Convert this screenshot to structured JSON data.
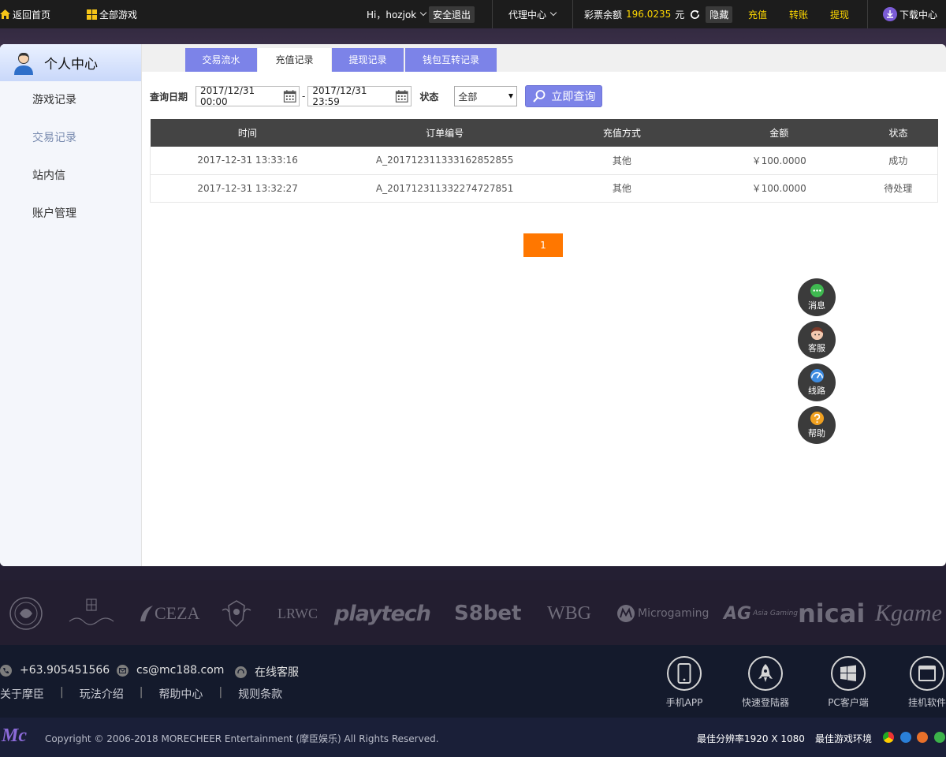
{
  "topbar": {
    "home_label": "返回首页",
    "all_games_label": "全部游戏",
    "greeting": "Hi，hozjok",
    "logout_label": "安全退出",
    "agent_center_label": "代理中心",
    "balance_label": "彩票余额",
    "balance_value": "196.0235",
    "currency": "元",
    "hide_label": "隐藏",
    "recharge_label": "充值",
    "transfer_label": "转账",
    "withdraw_label": "提现",
    "download_label": "下载中心"
  },
  "sidebar": {
    "title": "个人中心",
    "items": [
      {
        "label": "游戏记录"
      },
      {
        "label": "交易记录"
      },
      {
        "label": "站内信"
      },
      {
        "label": "账户管理"
      }
    ]
  },
  "tabs": [
    {
      "label": "交易流水"
    },
    {
      "label": "充值记录"
    },
    {
      "label": "提现记录"
    },
    {
      "label": "钱包互转记录"
    }
  ],
  "filter": {
    "date_label": "查询日期",
    "start": "2017/12/31 00:00",
    "dash": "-",
    "end": "2017/12/31 23:59",
    "status_label": "状态",
    "status_value": "全部",
    "query_label": "立即查询"
  },
  "table": {
    "headers": [
      "时间",
      "订单编号",
      "充值方式",
      "金额",
      "状态"
    ],
    "rows": [
      [
        "2017-12-31 13:33:16",
        "A_201712311333162852855",
        "其他",
        "￥100.0000",
        "成功"
      ],
      [
        "2017-12-31 13:32:27",
        "A_201712311332274727851",
        "其他",
        "￥100.0000",
        "待处理"
      ]
    ]
  },
  "pager": {
    "current": "1"
  },
  "float": {
    "message": "消息",
    "service": "客服",
    "route": "线路",
    "help": "帮助"
  },
  "partners": {
    "ceza": "CEZA",
    "lrwc": "LRWC",
    "playtech": "playtech",
    "sbet": "S8bet",
    "wbg": "WBG",
    "microgaming": "Microgaming",
    "ag": "AG",
    "ag_sub": "Asia Gaming",
    "nicai": "nicai",
    "kgame": "Kgame"
  },
  "footer": {
    "phone": "+63.905451566",
    "email": "cs@mc188.com",
    "online_service": "在线客服",
    "links": [
      "关于摩臣",
      "玩法介绍",
      "帮助中心",
      "规则条款"
    ],
    "link_sep": "|",
    "apps": [
      {
        "label": "手机APP"
      },
      {
        "label": "快速登陆器"
      },
      {
        "label": "PC客户端"
      },
      {
        "label": "挂机软件"
      }
    ]
  },
  "copyright": {
    "logo": "Mc",
    "text": "Copyright © 2006-2018 MORECHEER Entertainment (摩臣娱乐) All Rights Reserved.",
    "resolution": "最佳分辨率1920 X 1080",
    "env": "最佳游戏环境"
  },
  "colors": {
    "accent": "#7c83e8",
    "pager": "#ff7700",
    "balance": "#ffd800"
  }
}
